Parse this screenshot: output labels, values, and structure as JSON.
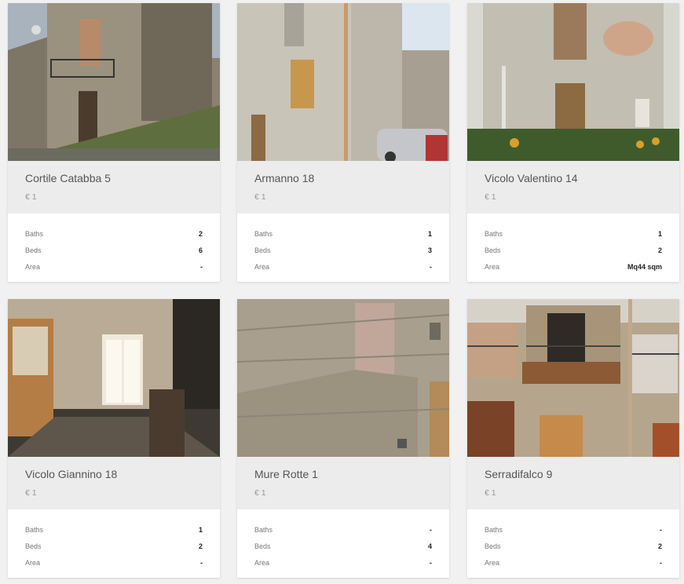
{
  "listings": [
    {
      "title": "Cortile Catabba 5",
      "price": "€ 1",
      "baths_label": "Baths",
      "baths": "2",
      "beds_label": "Beds",
      "beds": "6",
      "area_label": "Area",
      "area": "-"
    },
    {
      "title": "Armanno 18",
      "price": "€ 1",
      "baths_label": "Baths",
      "baths": "1",
      "beds_label": "Beds",
      "beds": "3",
      "area_label": "Area",
      "area": "-"
    },
    {
      "title": "Vicolo Valentino 14",
      "price": "€ 1",
      "baths_label": "Baths",
      "baths": "1",
      "beds_label": "Beds",
      "beds": "2",
      "area_label": "Area",
      "area": "Mq44 sqm"
    },
    {
      "title": "Vicolo Giannino 18",
      "price": "€ 1",
      "baths_label": "Baths",
      "baths": "1",
      "beds_label": "Beds",
      "beds": "2",
      "area_label": "Area",
      "area": "-"
    },
    {
      "title": "Mure Rotte 1",
      "price": "€ 1",
      "baths_label": "Baths",
      "baths": "-",
      "beds_label": "Beds",
      "beds": "4",
      "area_label": "Area",
      "area": "-"
    },
    {
      "title": "Serradifalco 9",
      "price": "€ 1",
      "baths_label": "Baths",
      "baths": "-",
      "beds_label": "Beds",
      "beds": "2",
      "area_label": "Area",
      "area": "-"
    }
  ]
}
